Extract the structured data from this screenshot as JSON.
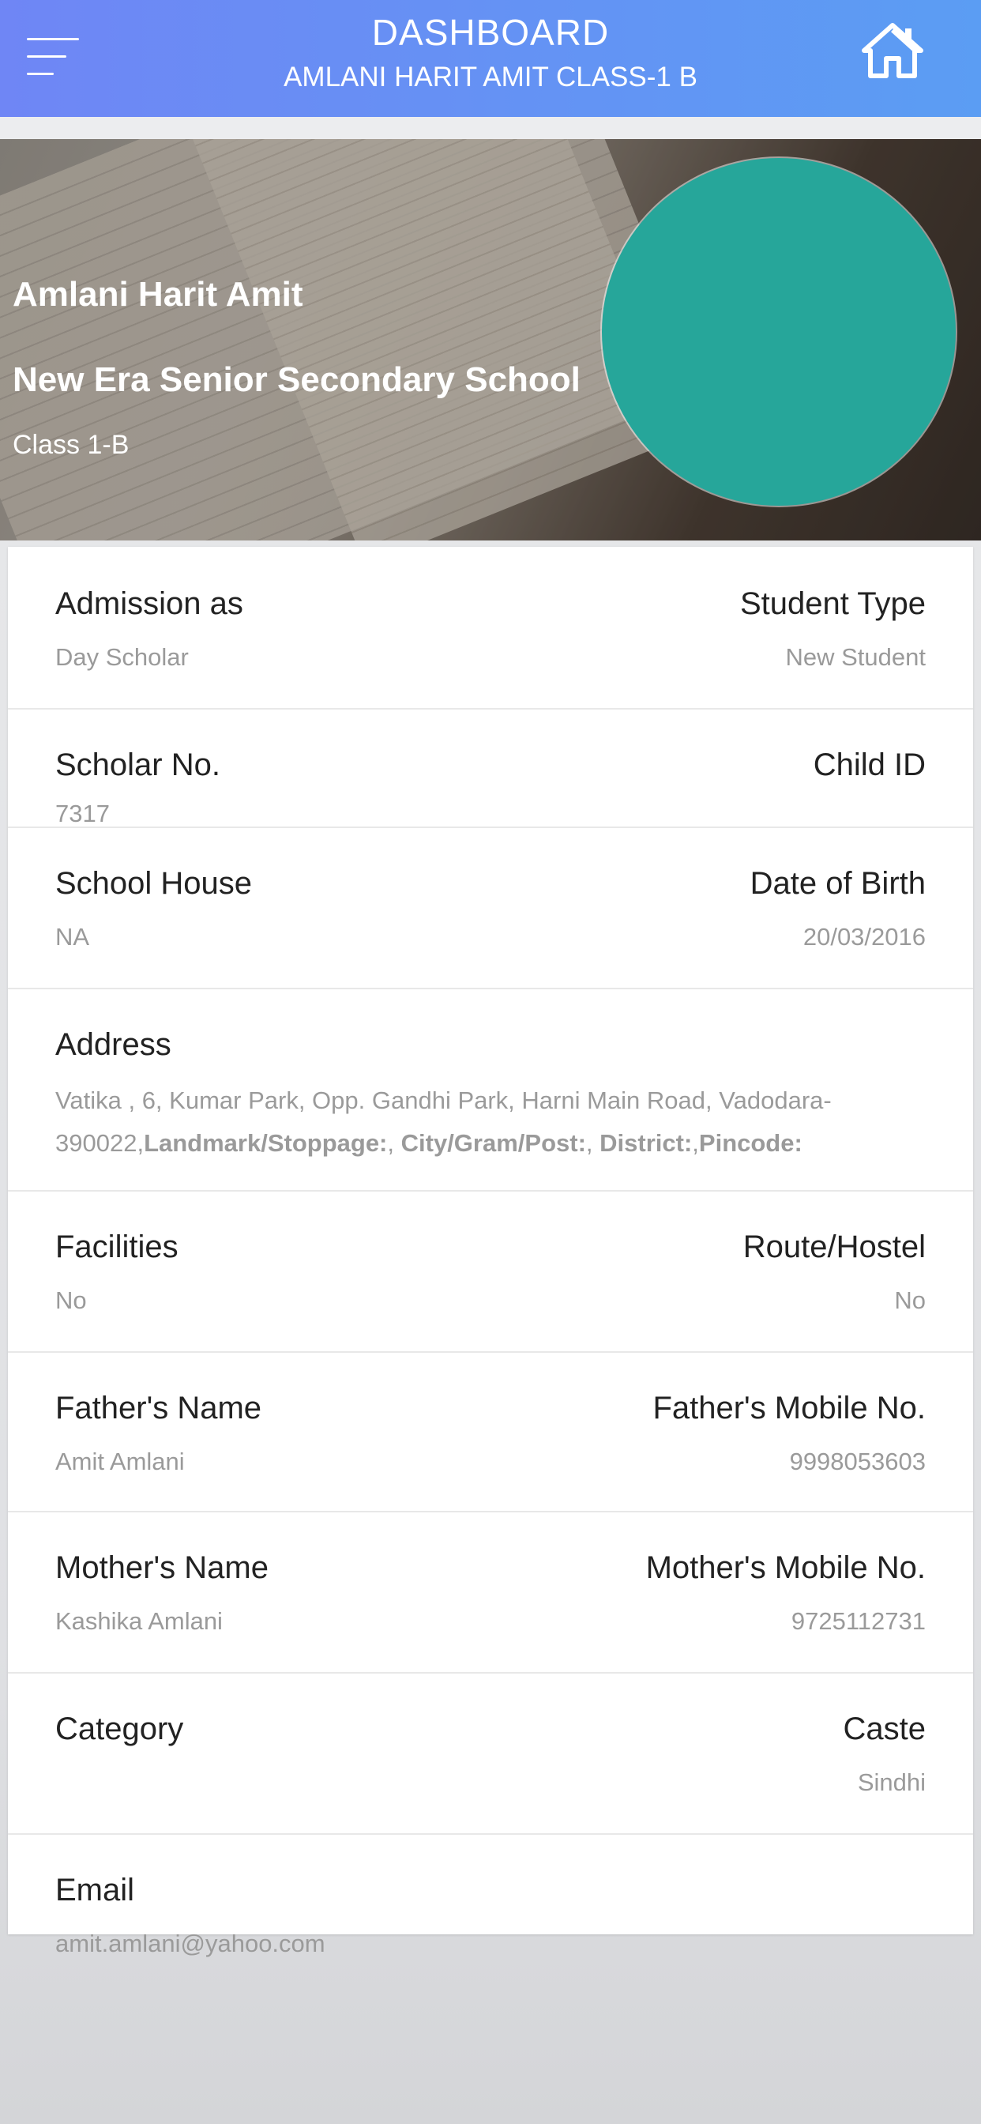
{
  "header": {
    "title": "DASHBOARD",
    "subtitle": "AMLANI HARIT AMIT CLASS-1 B",
    "gradient_start": "#6f86f5",
    "gradient_end": "#5b9df3"
  },
  "icons": {
    "menu": "hamburger-menu-icon",
    "home": "home-icon"
  },
  "profile": {
    "name": "Amlani Harit Amit",
    "school": "New Era Senior Secondary School",
    "class": "Class 1-B",
    "avatar_color": "#26a69a"
  },
  "details": {
    "admission_label": "Admission as",
    "admission_value": "Day Scholar",
    "student_type_label": "Student Type",
    "student_type_value": "New Student",
    "scholar_no_label": "Scholar No.",
    "scholar_no_value": "7317",
    "child_id_label": "Child ID",
    "child_id_value": "",
    "school_house_label": "School House",
    "school_house_value": "NA",
    "dob_label": "Date of Birth",
    "dob_value": "20/03/2016",
    "address_label": "Address",
    "address_text": "Vatika , 6, Kumar Park, Opp. Gandhi Park, Harni Main Road, Vadodara-390022,",
    "address_landmark_label": "Landmark/Stoppage:",
    "address_city_label": "City/Gram/Post:",
    "address_district_label": "District:",
    "address_pincode_label": "Pincode:",
    "facilities_label": "Facilities",
    "facilities_value": "No",
    "route_label": "Route/Hostel",
    "route_value": "No",
    "father_name_label": "Father's Name",
    "father_name_value": "Amit Amlani",
    "father_mobile_label": "Father's Mobile No.",
    "father_mobile_value": "9998053603",
    "mother_name_label": "Mother's Name",
    "mother_name_value": "Kashika Amlani",
    "mother_mobile_label": "Mother's Mobile No.",
    "mother_mobile_value": "9725112731",
    "category_label": "Category",
    "category_value": "",
    "caste_label": "Caste",
    "caste_value": "Sindhi",
    "email_label": "Email",
    "email_value": "amit.amlani@yahoo.com"
  }
}
